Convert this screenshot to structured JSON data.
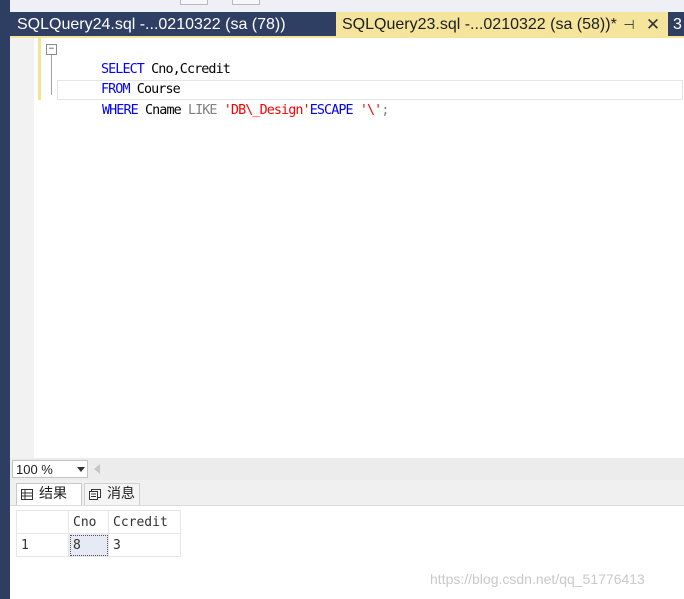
{
  "tabs": {
    "inactive_label": "SQLQuery24.sql -...0210322 (sa (78))",
    "active_label": "SQLQuery23.sql -...0210322 (sa (58))*",
    "overflow_label": "3",
    "pin_icon": "pin-icon",
    "close_icon": "close-icon",
    "active_color": "#f5e49c",
    "strip_color": "#2e3f63"
  },
  "editor": {
    "lines": [
      {
        "kw": "SELECT",
        "rest": " Cno,Ccredit"
      },
      {
        "kw": "FROM",
        "rest": " Course"
      },
      {
        "kw": "WHERE",
        "ident": " Cname ",
        "op": "LIKE",
        "str1": " 'DB\\_Design'",
        "kw2": "ESCAPE",
        "str2": " '\\'",
        "end": ";"
      }
    ],
    "fold_glyph": "−"
  },
  "zoom": {
    "value": "100 %"
  },
  "results": {
    "tabs": [
      {
        "label": "结果",
        "icon": "grid-icon"
      },
      {
        "label": "消息",
        "icon": "messages-icon"
      }
    ],
    "columns": [
      "Cno",
      "Ccredit"
    ],
    "rows": [
      {
        "num": "1",
        "cells": [
          "8",
          "3"
        ]
      }
    ]
  },
  "watermark": "https://blog.csdn.net/qq_51776413"
}
